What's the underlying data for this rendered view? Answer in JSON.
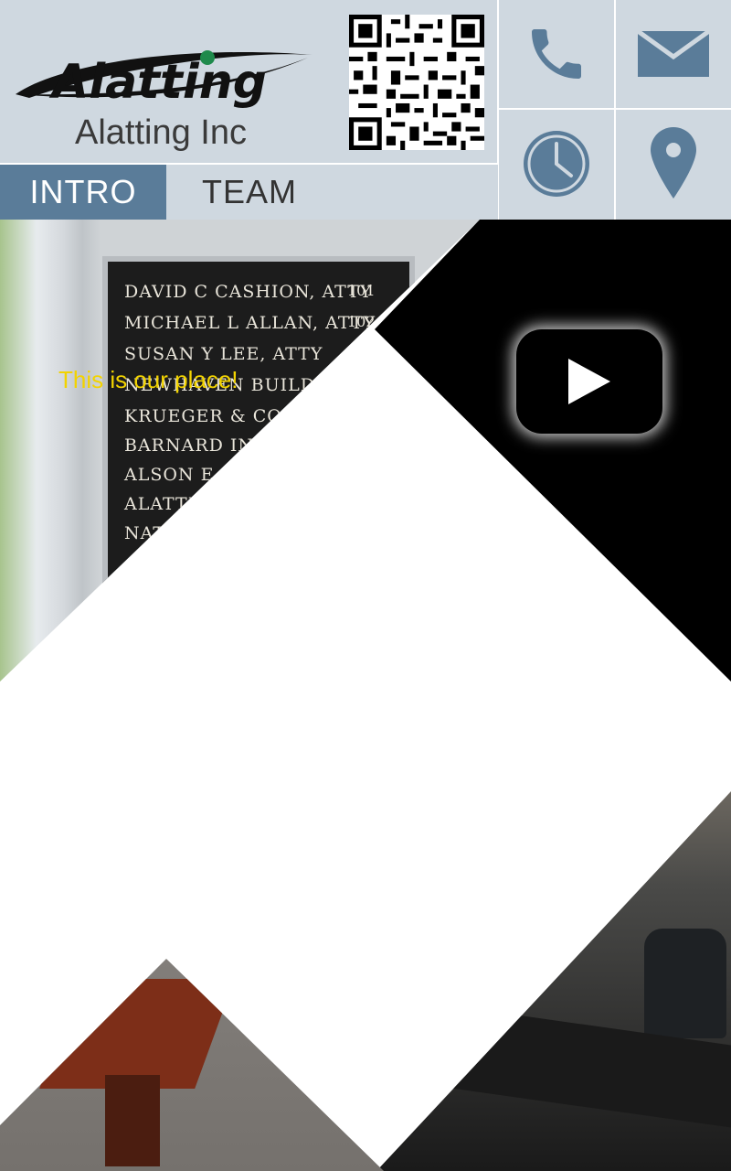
{
  "header": {
    "logo_text": "Alatting",
    "company_name": "Alatting Inc",
    "qr_label": "qr-code"
  },
  "contact_tiles": [
    {
      "name": "phone-icon"
    },
    {
      "name": "mail-icon"
    },
    {
      "name": "clock-icon"
    },
    {
      "name": "location-pin-icon"
    }
  ],
  "tabs": [
    {
      "label": "INTRO",
      "active": true
    },
    {
      "label": "TEAM",
      "active": false
    },
    {
      "label": "",
      "active": false
    }
  ],
  "directory_photo": {
    "caption": "This is our place!",
    "entries": [
      {
        "text": "DAVID C CASHION, ATTY",
        "num": "101"
      },
      {
        "text": "MICHAEL L ALLAN, ATTY",
        "num": "102"
      },
      {
        "text": "SUSAN Y LEE, ATTY",
        "num": ""
      },
      {
        "text": "NEWHAVEN BUILDERS, INC",
        "num": ""
      },
      {
        "text": "KRUEGER & COMPANY",
        "num": ""
      },
      {
        "text": "BARNARD INVESTMENT",
        "num": ""
      },
      {
        "text": "ALSON E HALL",
        "num": ""
      },
      {
        "text": "ALATTING",
        "num": ""
      },
      {
        "text": "NATION",
        "num": ""
      }
    ]
  },
  "colors": {
    "header_bg": "#cfd8e0",
    "accent": "#5a7c99",
    "caption": "#f2d300",
    "video_bg": "#000000"
  }
}
